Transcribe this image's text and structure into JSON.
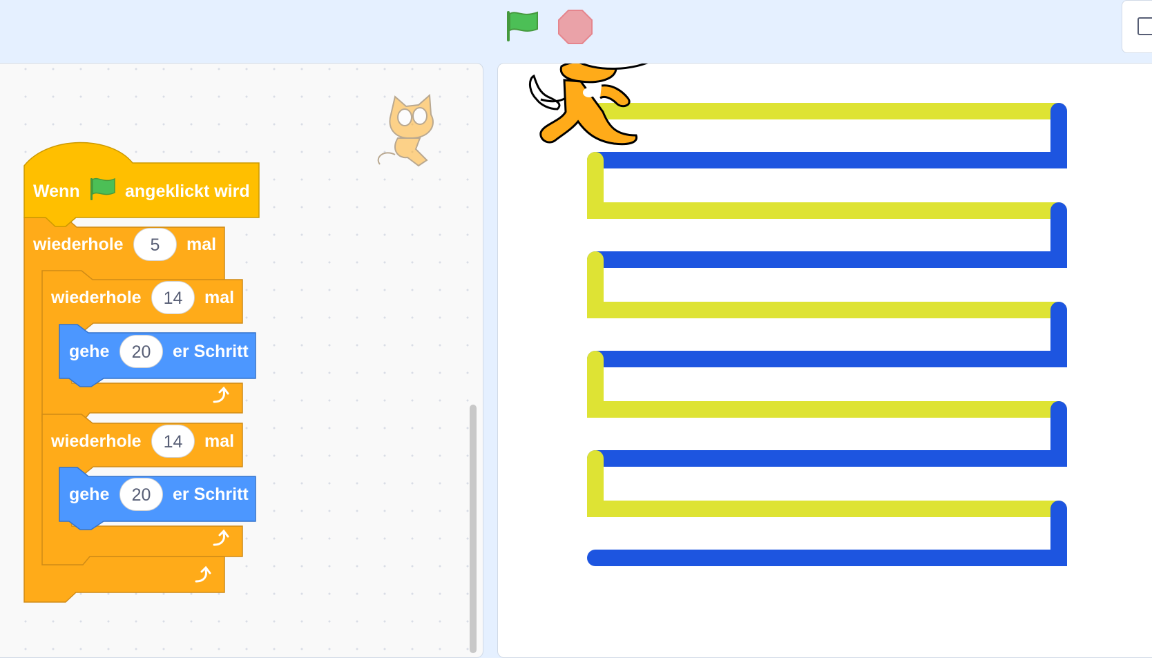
{
  "toolbar": {
    "green_flag": "green-flag-icon",
    "stop": "stop-sign-icon",
    "mode": "small-stage-icon"
  },
  "script": {
    "hat_label_1": "Wenn",
    "hat_label_2": "angeklickt wird",
    "repeat_outer_label": "wiederhole",
    "repeat_outer_count": "5",
    "repeat_outer_unit": "mal",
    "repeat_1_label": "wiederhole",
    "repeat_1_count": "14",
    "repeat_1_unit": "mal",
    "move_1_label": "gehe",
    "move_1_steps": "20",
    "move_1_unit": "er Schritt",
    "repeat_2_label": "wiederhole",
    "repeat_2_count": "14",
    "repeat_2_unit": "mal",
    "move_2_label": "gehe",
    "move_2_steps": "20",
    "move_2_unit": "er Schritt"
  },
  "colors": {
    "control": "#ffab19",
    "events": "#ffbf00",
    "motion": "#4c97ff",
    "pen_yellow": "#dee334",
    "pen_blue": "#1d55e0"
  }
}
